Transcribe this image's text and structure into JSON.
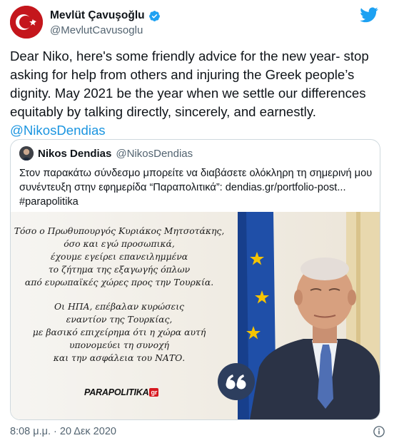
{
  "author": {
    "display_name": "Mevlüt Çavuşoğlu",
    "handle": "@MevlutCavusoglu"
  },
  "tweet": {
    "text": "Dear Niko, here's some friendly advice for the new year- stop asking for help from others and injuring the Greek people’s dignity. May 2021 be the year when we settle our differences equitably by talking directly, sincerely, and earnestly.",
    "mention": "@NikosDendias"
  },
  "quoted": {
    "display_name": "Nikos Dendias",
    "handle": "@NikosDendias",
    "text": "Στον παρακάτω σύνδεσμο μπορείτε να διαβάσετε ολόκληρη τη σημερινή μου συνέντευξη στην εφημερίδα “Παραπολιτικά”: dendias.gr/portfolio-post... #parapolitika",
    "image_quote": {
      "para1": [
        "Τόσο ο Πρωθυπουργός Κυριάκος Μητσοτάκης,",
        "όσο και εγώ προσωπικά,",
        "έχουμε εγείρει επανειλημμένα",
        "το ζήτημα της εξαγωγής όπλων",
        "από ευρωπαϊκές χώρες προς την Τουρκία."
      ],
      "para2": [
        "Οι ΗΠΑ, επέβαλαν κυρώσεις",
        "εναντίον της Τουρκίας,",
        "με βασικό επιχείρημα ότι η χώρα αυτή",
        "υπονομεύει τη συνοχή",
        "και την ασφάλεια του ΝΑΤΟ."
      ],
      "brand": "PARAPOLITIKA",
      "brand_tag": "gr",
      "badge_glyph": "“"
    }
  },
  "footer": {
    "timestamp": "8:08 μ.μ. · 20 Δεκ 2020"
  },
  "colors": {
    "link": "#1b95e0",
    "twitter_blue": "#1da1f2",
    "turkey_red": "#c4161c",
    "eu_blue": "#1f4fa8"
  },
  "icons": [
    "verified-icon",
    "twitter-bird-icon",
    "info-icon"
  ]
}
